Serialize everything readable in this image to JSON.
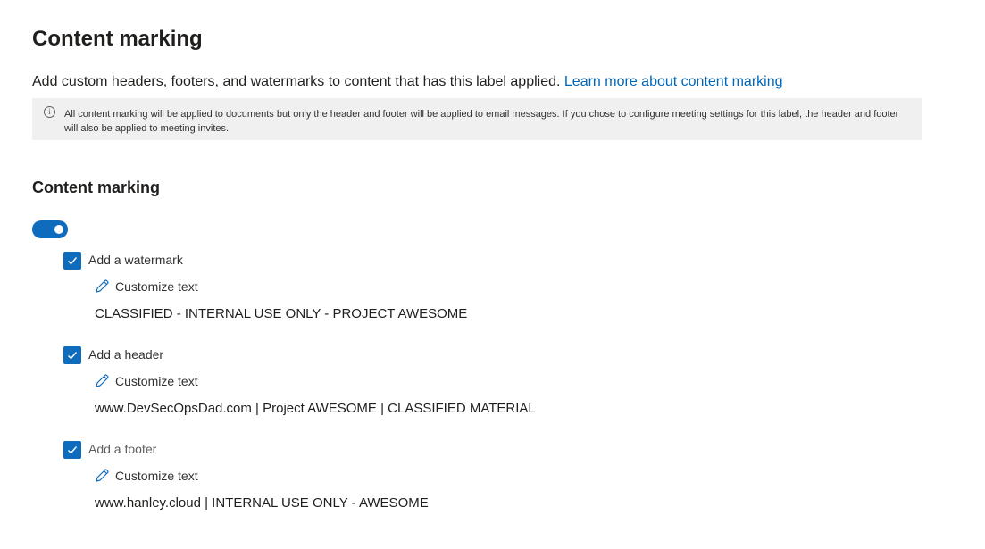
{
  "page": {
    "title": "Content marking",
    "intro_text": "Add custom headers, footers, and watermarks to content that has this label applied.",
    "learn_more_link": "Learn more about content marking"
  },
  "info_bar": {
    "text": "All content marking will be applied to documents but only the header and footer will be applied to email messages. If you chose to configure meeting settings for this label, the header and footer will also be applied to meeting invites.",
    "icon": "info-icon"
  },
  "section": {
    "title": "Content marking",
    "toggle_on": true
  },
  "options": [
    {
      "label": "Add a watermark",
      "checked": true,
      "customize_label": "Customize text",
      "value": "CLASSIFIED - INTERNAL USE ONLY - PROJECT AWESOME"
    },
    {
      "label": "Add a header",
      "checked": true,
      "customize_label": "Customize text",
      "value": "www.DevSecOpsDad.com | Project AWESOME | CLASSIFIED MATERIAL"
    },
    {
      "label": "Add a footer",
      "checked": true,
      "customize_label": "Customize text",
      "value": "www.hanley.cloud | INTERNAL USE ONLY - AWESOME"
    }
  ],
  "colors": {
    "accent": "#0f6cbd",
    "link": "#0067b8",
    "info_bg": "#f0f0f0"
  }
}
